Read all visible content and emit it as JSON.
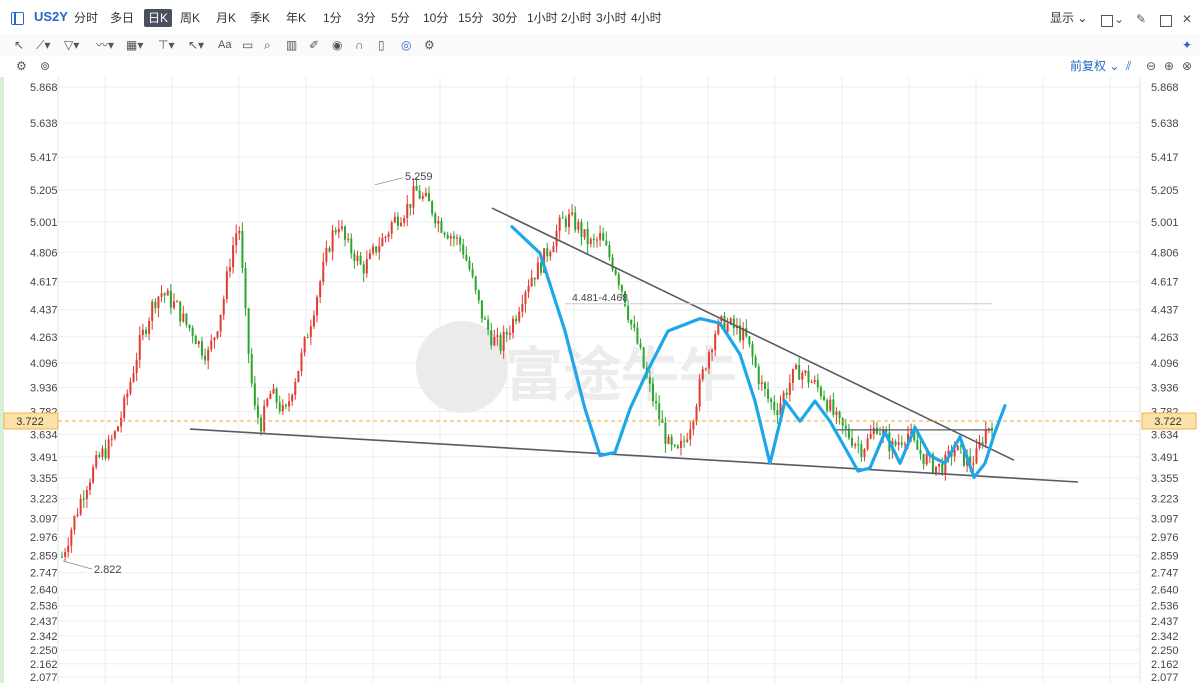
{
  "header": {
    "symbol": "US2Y",
    "periods": [
      "分时",
      "多日",
      "日K",
      "周K",
      "月K",
      "季K",
      "年K",
      "1分",
      "3分",
      "5分",
      "10分",
      "15分",
      "30分",
      "1小时",
      "2小时",
      "3小时",
      "4小时"
    ],
    "active_period": "日K",
    "display_label": "显示"
  },
  "toolbar": {
    "aa_label": "Aa",
    "adjust_label": "前复权"
  },
  "colors": {
    "up": "#e23b32",
    "down": "#2aa52d",
    "trendline": "#555a66",
    "drawing": "#1ea7e8",
    "price_line": "#f0a030",
    "price_box": "#fbe3a8",
    "grid": "#eeeeee",
    "watermark": "#e6e6e6"
  },
  "watermark_text": "富途牛牛",
  "chart_data": {
    "type": "candlestick",
    "ylim": [
      2.077,
      5.868
    ],
    "y_ticks": [
      "5.868",
      "5.638",
      "5.417",
      "5.205",
      "5.001",
      "4.806",
      "4.617",
      "4.437",
      "4.263",
      "4.096",
      "3.936",
      "3.782",
      "3.634",
      "3.491",
      "3.355",
      "3.223",
      "3.097",
      "2.976",
      "2.859",
      "2.747",
      "2.640",
      "2.536",
      "2.437",
      "2.342",
      "2.250",
      "2.162",
      "2.077"
    ],
    "current_price": "3.722",
    "annotations": [
      {
        "label": "5.259",
        "value": 5.259
      },
      {
        "label": "2.822",
        "value": 2.822
      },
      {
        "label": "4.481-4.468",
        "value": 4.475
      }
    ],
    "approx_closes": [
      2.85,
      3.0,
      3.15,
      3.3,
      3.4,
      3.5,
      3.55,
      3.65,
      3.8,
      4.0,
      4.2,
      4.35,
      4.5,
      4.55,
      4.5,
      4.45,
      4.35,
      4.3,
      4.2,
      4.15,
      4.3,
      4.5,
      4.8,
      5.0,
      4.3,
      3.8,
      3.7,
      3.9,
      3.85,
      3.75,
      3.95,
      4.1,
      4.3,
      4.5,
      4.7,
      4.9,
      5.0,
      4.85,
      4.8,
      4.7,
      4.75,
      4.85,
      4.9,
      5.0,
      5.05,
      5.1,
      5.2,
      5.15,
      5.1,
      5.0,
      4.95,
      4.9,
      4.85,
      4.7,
      4.5,
      4.35,
      4.25,
      4.2,
      4.3,
      4.4,
      4.55,
      4.65,
      4.7,
      4.8,
      4.9,
      5.0,
      5.02,
      4.98,
      4.9,
      4.85,
      4.9,
      4.8,
      4.7,
      4.55,
      4.35,
      4.2,
      4.0,
      3.85,
      3.7,
      3.55,
      3.5,
      3.6,
      3.75,
      3.95,
      4.15,
      4.3,
      4.35,
      4.33,
      4.3,
      4.25,
      4.1,
      3.95,
      3.85,
      3.8,
      3.9,
      4.0,
      4.05,
      4.0,
      3.95,
      3.9,
      3.8,
      3.7,
      3.65,
      3.6,
      3.55,
      3.6,
      3.7,
      3.62,
      3.55,
      3.6,
      3.65,
      3.55,
      3.5,
      3.45,
      3.42,
      3.45,
      3.55,
      3.5,
      3.45,
      3.5,
      3.65,
      3.72
    ]
  }
}
